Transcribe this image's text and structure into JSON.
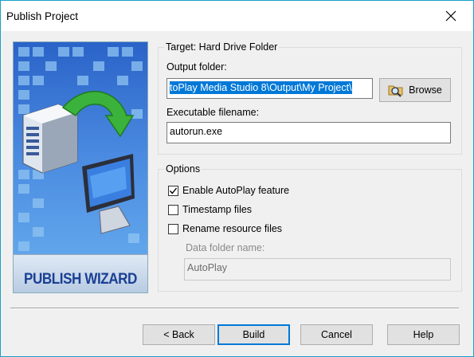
{
  "window": {
    "title": "Publish Project"
  },
  "wizard_image": {
    "label": "PUBLISH WIZARD"
  },
  "target": {
    "legend": "Target: Hard Drive Folder",
    "output_folder_label": "Output folder:",
    "output_folder_value": "toPlay Media Studio 8\\Output\\My Project\\",
    "browse_label": "Browse",
    "executable_label": "Executable filename:",
    "executable_value": "autorun.exe"
  },
  "options": {
    "legend": "Options",
    "enable_autoplay": {
      "label": "Enable AutoPlay feature",
      "checked": true
    },
    "timestamp_files": {
      "label": "Timestamp files",
      "checked": false
    },
    "rename_resource": {
      "label": "Rename resource files",
      "checked": false
    },
    "data_folder_label": "Data folder name:",
    "data_folder_value": "AutoPlay"
  },
  "buttons": {
    "back": "< Back",
    "build": "Build",
    "cancel": "Cancel",
    "help": "Help"
  },
  "colors": {
    "accent": "#0078d7",
    "window_border": "#18a0c8"
  }
}
